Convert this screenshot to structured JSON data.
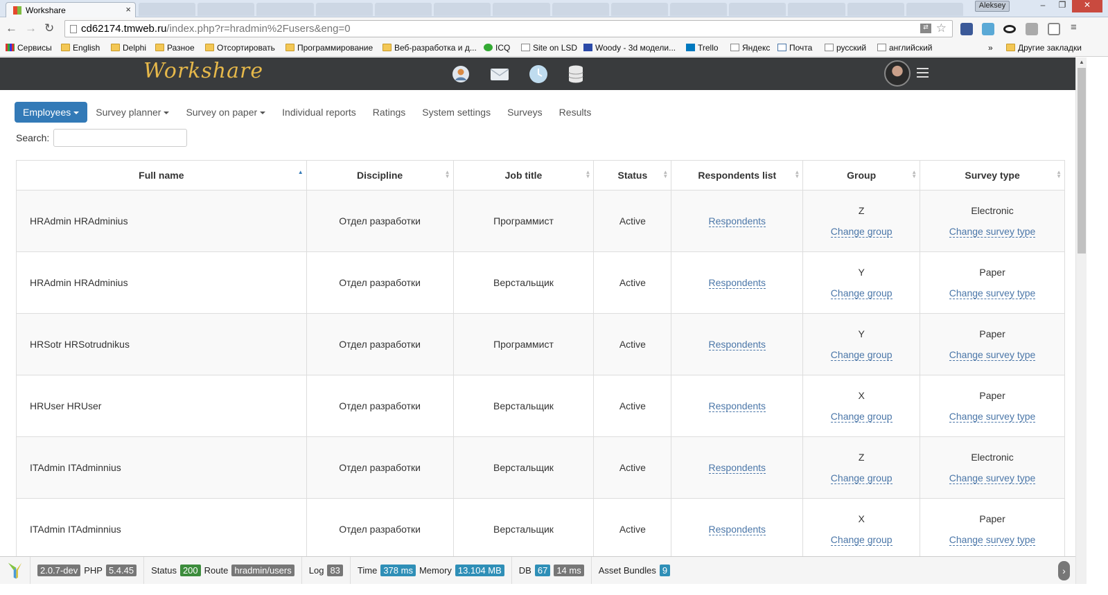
{
  "browser": {
    "tab_title": "Workshare",
    "tab_close": "×",
    "user_badge": "Aleksey",
    "win_min": "‒",
    "win_max": "❐",
    "win_close": "✕",
    "url_host": "cd62174.tmweb.ru",
    "url_path": "/index.php?r=hradmin%2Fusers&eng=0",
    "bookmarks": [
      "Сервисы",
      "English",
      "Delphi",
      "Разное",
      "Отсортировать",
      "Программирование",
      "Веб-разработка и д...",
      "ICQ",
      "Site on LSD",
      "Woody - 3d модели...",
      "Trello",
      "Яндекс",
      "Почта",
      "русский",
      "английский"
    ],
    "bookmarks_more": "»",
    "other_bookmarks": "Другие закладки"
  },
  "app": {
    "logo": "Workshare",
    "header_icons": [
      "profile-icon",
      "mail-icon",
      "clock-icon",
      "database-icon"
    ]
  },
  "nav": {
    "items": [
      {
        "label": "Employees",
        "dropdown": true,
        "active": true
      },
      {
        "label": "Survey planner",
        "dropdown": true
      },
      {
        "label": "Survey on paper",
        "dropdown": true
      },
      {
        "label": "Individual reports"
      },
      {
        "label": "Ratings"
      },
      {
        "label": "System settings"
      },
      {
        "label": "Surveys"
      },
      {
        "label": "Results"
      }
    ]
  },
  "search": {
    "label": "Search:",
    "value": ""
  },
  "table": {
    "headers": [
      "Full name",
      "Discipline",
      "Job title",
      "Status",
      "Respondents list",
      "Group",
      "Survey type"
    ],
    "link_respondents": "Respondents",
    "link_change_group": "Change group",
    "link_change_type": "Change survey type",
    "rows": [
      {
        "name": "HRAdmin HRAdminius",
        "discipline": "Отдел разработки",
        "job": "Программист",
        "status": "Active",
        "group": "Z",
        "type": "Electronic"
      },
      {
        "name": "HRAdmin HRAdminius",
        "discipline": "Отдел разработки",
        "job": "Верстальщик",
        "status": "Active",
        "group": "Y",
        "type": "Paper"
      },
      {
        "name": "HRSotr HRSotrudnikus",
        "discipline": "Отдел разработки",
        "job": "Программист",
        "status": "Active",
        "group": "Y",
        "type": "Paper"
      },
      {
        "name": "HRUser HRUser",
        "discipline": "Отдел разработки",
        "job": "Верстальщик",
        "status": "Active",
        "group": "X",
        "type": "Paper"
      },
      {
        "name": "ITAdmin ITAdminnius",
        "discipline": "Отдел разработки",
        "job": "Верстальщик",
        "status": "Active",
        "group": "Z",
        "type": "Electronic"
      },
      {
        "name": "ITAdmin ITAdminnius",
        "discipline": "Отдел разработки",
        "job": "Верстальщик",
        "status": "Active",
        "group": "X",
        "type": "Paper"
      }
    ]
  },
  "debug": {
    "version": "2.0.7-dev",
    "php_label": "PHP",
    "php": "5.4.45",
    "status_label": "Status",
    "status": "200",
    "route_label": "Route",
    "route": "hradmin/users",
    "log_label": "Log",
    "log": "83",
    "time_label": "Time",
    "time": "378 ms",
    "memory_label": "Memory",
    "memory": "13.104 MB",
    "db_label": "DB",
    "db_queries": "67",
    "db_time": "14 ms",
    "assets_label": "Asset Bundles",
    "assets": "9",
    "toggle": "›"
  },
  "colors": {
    "primary": "#337ab7",
    "header_bg": "#393b3d",
    "logo": "#e6b84a",
    "link": "#4a76a8"
  }
}
